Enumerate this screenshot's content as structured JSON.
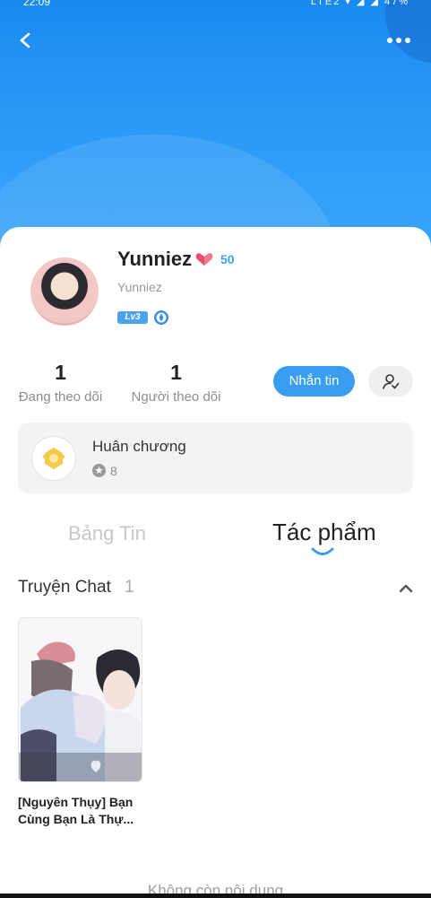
{
  "status_bar": {
    "time": "22:09",
    "right": "LTE2 ▾ ◢ ◢ 47%"
  },
  "colors": {
    "header_blue": "#2d9bf7",
    "accent_blue": "#3a9ef0",
    "card_gray": "#f3f3f3"
  },
  "profile": {
    "name": "Yunniez",
    "popularity": "50",
    "username": "Yunniez",
    "level": "Lv3",
    "icons": [
      "heart-icon",
      "verified-badge-icon"
    ]
  },
  "stats": {
    "following_count": "1",
    "following_label": "Đang theo dõi",
    "followers_count": "1",
    "followers_label": "Người theo dõi"
  },
  "actions": {
    "message_label": "Nhắn tin",
    "follow_icon": "add-friend-icon"
  },
  "medals": {
    "title": "Huân chương",
    "count": "8"
  },
  "tabs": [
    {
      "label": "Bảng Tin",
      "active": false
    },
    {
      "label": "Tác phẩm",
      "active": true
    }
  ],
  "section": {
    "title": "Truyện Chat",
    "count": "1"
  },
  "works": [
    {
      "title": "[Nguyên Thụy] Bạn Cùng Bạn Là Thự..."
    }
  ],
  "footer": {
    "end_text": "Không còn nội dung"
  }
}
